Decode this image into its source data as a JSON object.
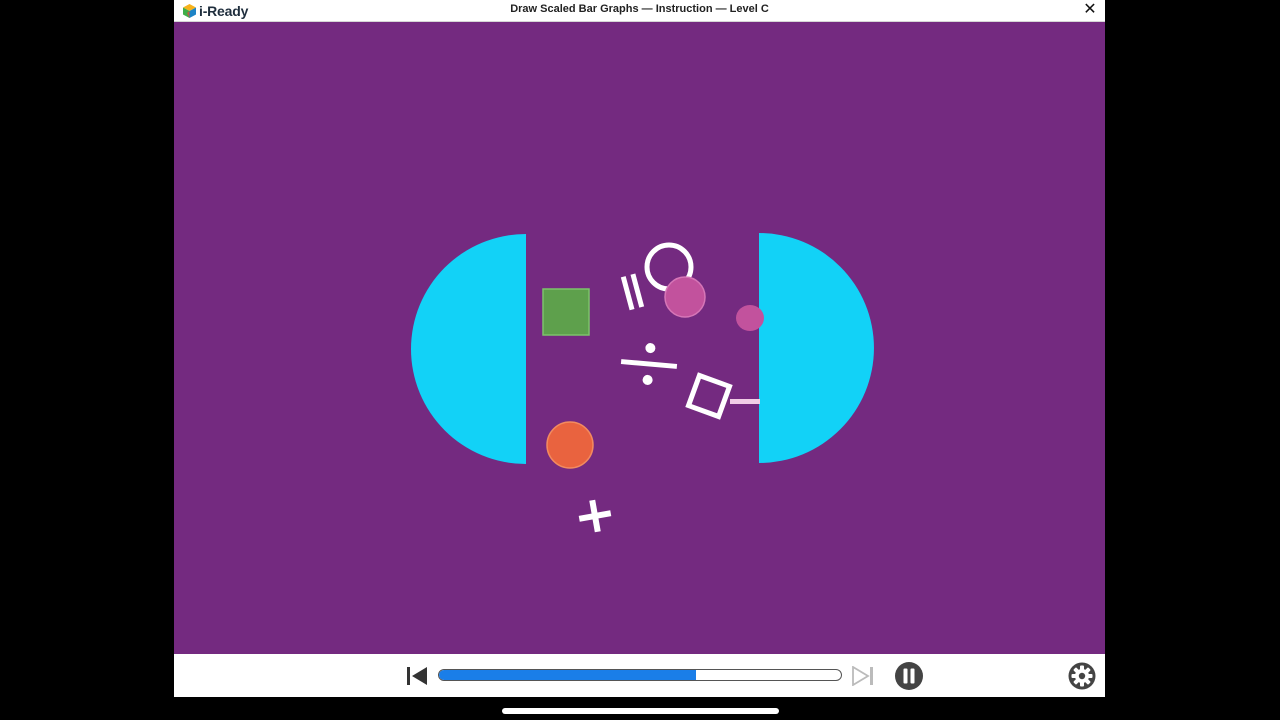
{
  "app": {
    "brand": "i-Ready",
    "title": "Draw Scaled Bar Graphs — Instruction — Level C",
    "close_glyph": "✕"
  },
  "stage": {
    "background": "#742a80",
    "shapes": {
      "half_circle_color": "#12d2f7",
      "square_color": "#5ea04c",
      "orange_circle_color": "#e9633f",
      "pink_circle_color": "#c2529d",
      "symbol_color": "#ffffff"
    }
  },
  "controls": {
    "rewind_icon": "skip-back-icon",
    "skip_icon": "skip-forward-icon",
    "pause_icon": "pause-icon",
    "settings_icon": "gear-icon",
    "progress_fraction": 0.64,
    "progress_color": "#1a7ee8"
  }
}
